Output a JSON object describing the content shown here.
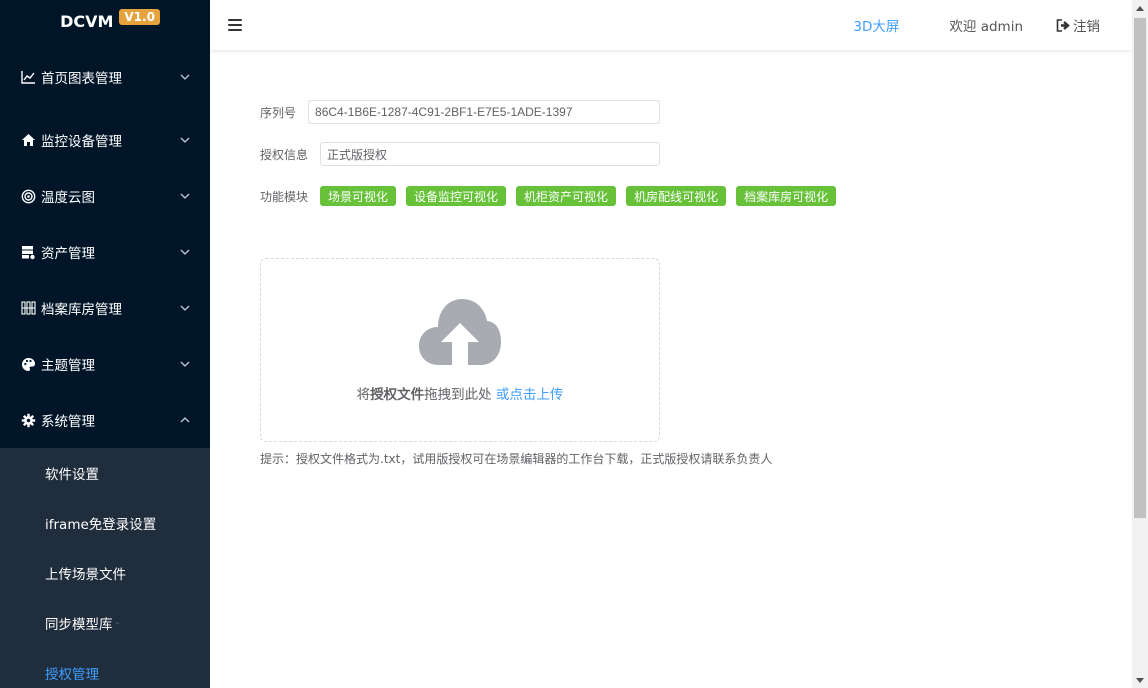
{
  "brand": {
    "name": "DCVM",
    "version": "V1.0"
  },
  "sidebar": {
    "items": [
      {
        "label": "首页图表管理",
        "icon": "chart-line-icon"
      },
      {
        "label": "监控设备管理",
        "icon": "home-icon"
      },
      {
        "label": "温度云图",
        "icon": "radar-icon"
      },
      {
        "label": "资产管理",
        "icon": "server-gear-icon"
      },
      {
        "label": "档案库房管理",
        "icon": "shelves-icon"
      },
      {
        "label": "主题管理",
        "icon": "palette-icon"
      },
      {
        "label": "系统管理",
        "icon": "gear-icon",
        "expanded": true
      }
    ],
    "sub_items": [
      {
        "label": "软件设置"
      },
      {
        "label": "iframe免登录设置"
      },
      {
        "label": "上传场景文件"
      },
      {
        "label": "同步模型库",
        "suffix": "-"
      },
      {
        "label": "授权管理",
        "active": true
      }
    ]
  },
  "header": {
    "link_3d": "3D大屏",
    "welcome": "欢迎 admin",
    "logout": "注销"
  },
  "form": {
    "serial_label": "序列号",
    "serial_value": "86C4-1B6E-1287-4C91-2BF1-E7E5-1ADE-1397",
    "license_label": "授权信息",
    "license_value": "正式版授权",
    "modules_label": "功能模块",
    "modules": [
      "场景可视化",
      "设备监控可视化",
      "机柜资产可视化",
      "机房配线可视化",
      "档案库房可视化"
    ]
  },
  "upload": {
    "text_prefix": "将",
    "text_bold": "授权文件",
    "text_suffix": "拖拽到此处",
    "link": "或点击上传"
  },
  "tip": "提示：授权文件格式为.txt，试用版授权可在场景编辑器的工作台下载，正式版授权请联系负责人",
  "colors": {
    "sidebar_bg": "#001528",
    "submenu_bg": "#1f2d3d",
    "accent": "#409eff",
    "tag": "#67c23a",
    "badge": "#e6a23c"
  }
}
